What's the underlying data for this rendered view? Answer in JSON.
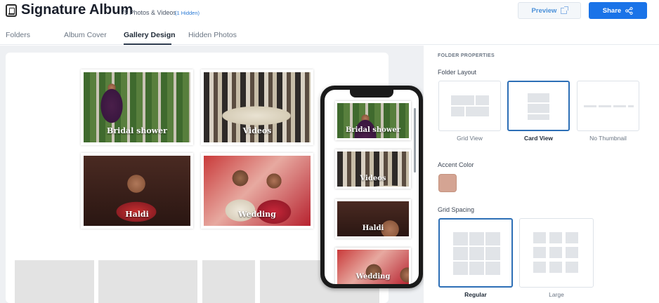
{
  "header": {
    "title": "Signature Album",
    "count": "75 Photos & Videos",
    "hidden": "(1 Hidden)",
    "preview_label": "Preview",
    "share_label": "Share"
  },
  "tabs": [
    {
      "label": "Folders",
      "active": false
    },
    {
      "label": "Album Cover",
      "active": false
    },
    {
      "label": "Gallery Design",
      "active": true
    },
    {
      "label": "Hidden Photos",
      "active": false
    }
  ],
  "gallery": {
    "folders": [
      "Bridal shower",
      "Videos",
      "Haldi",
      "Wedding"
    ]
  },
  "phone_preview": {
    "folders": [
      "Bridal shower",
      "Videos",
      "Haldi",
      "Wedding"
    ]
  },
  "panel": {
    "heading": "FOLDER PROPERTIES",
    "folder_layout": {
      "label": "Folder Layout",
      "options": [
        "Grid View",
        "Card View",
        "No Thumbnail"
      ],
      "selected": "Card View"
    },
    "accent_color": {
      "label": "Accent Color",
      "value": "#d4a493"
    },
    "grid_spacing": {
      "label": "Grid Spacing",
      "options": [
        "Regular",
        "Large"
      ],
      "selected": "Regular"
    }
  },
  "colors": {
    "primary": "#1a73e8",
    "selected_border": "#2d6fb6"
  }
}
